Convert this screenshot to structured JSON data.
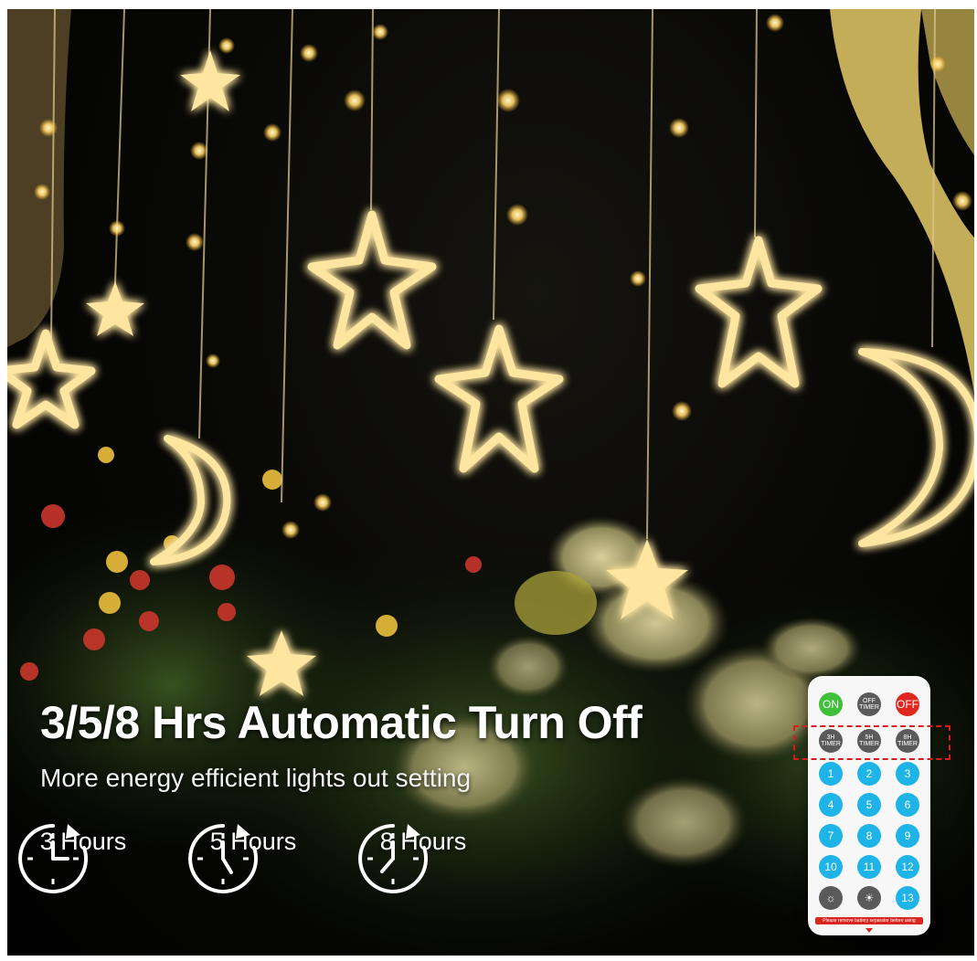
{
  "headline": "3/5/8 Hrs Automatic Turn Off",
  "subline": "More energy efficient lights out setting",
  "timers": [
    {
      "label": "3 Hours",
      "hours": 3
    },
    {
      "label": "5 Hours",
      "hours": 5
    },
    {
      "label": "8 Hours",
      "hours": 8
    }
  ],
  "remote": {
    "on": "ON",
    "off_timer": "OFF TIMER",
    "off": "OFF",
    "timer_3h": "3H TIMER",
    "timer_5h": "5H TIMER",
    "timer_8h": "8H TIMER",
    "numbers": [
      "1",
      "2",
      "3",
      "4",
      "5",
      "6",
      "7",
      "8",
      "9",
      "10",
      "11",
      "12",
      "13"
    ],
    "strip_text": "Please remove battery separator before using"
  },
  "colors": {
    "light": "#ffe9a8",
    "glow": "#ffcf5a",
    "button_blue": "#1fb4e8",
    "button_gray": "#5a5a5a",
    "button_red": "#e0261e",
    "button_green": "#3fbf3a"
  }
}
